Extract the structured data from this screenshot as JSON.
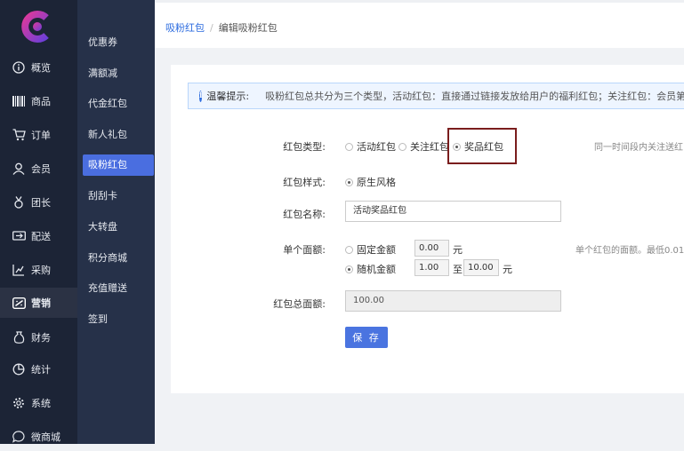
{
  "breadcrumb": {
    "parent": "吸粉红包",
    "current": "编辑吸粉红包"
  },
  "primary_nav": [
    {
      "label": "概览",
      "icon": "info-circle-icon"
    },
    {
      "label": "商品",
      "icon": "barcode-icon"
    },
    {
      "label": "订单",
      "icon": "cart-icon"
    },
    {
      "label": "会员",
      "icon": "user-icon"
    },
    {
      "label": "团长",
      "icon": "medal-icon"
    },
    {
      "label": "配送",
      "icon": "delivery-icon"
    },
    {
      "label": "采购",
      "icon": "purchase-icon"
    },
    {
      "label": "营销",
      "icon": "marketing-icon",
      "active": true
    },
    {
      "label": "财务",
      "icon": "money-bag-icon"
    },
    {
      "label": "统计",
      "icon": "pie-chart-icon"
    },
    {
      "label": "系统",
      "icon": "gear-icon"
    },
    {
      "label": "微商城",
      "icon": "chat-icon"
    }
  ],
  "secondary_nav": [
    {
      "label": "优惠券"
    },
    {
      "label": "满额减"
    },
    {
      "label": "代金红包"
    },
    {
      "label": "新人礼包"
    },
    {
      "label": "吸粉红包",
      "active": true
    },
    {
      "label": "刮刮卡"
    },
    {
      "label": "大转盘"
    },
    {
      "label": "积分商城"
    },
    {
      "label": "充值赠送"
    },
    {
      "label": "签到"
    }
  ],
  "notice": {
    "title": "温馨提示:",
    "text": "吸粉红包总共分为三个类型，活动红包：直接通过链接发放给用户的福利红包；关注红包：会员第一次"
  },
  "form": {
    "type_label": "红包类型:",
    "type_options": [
      "活动红包",
      "关注红包",
      "奖品红包"
    ],
    "type_selected": "奖品红包",
    "type_hint": "同一时间段内关注送红",
    "style_label": "红包样式:",
    "style_option": "原生风格",
    "name_label": "红包名称:",
    "name_value": "活动奖品红包",
    "amount_label": "单个面额:",
    "fixed_label": "固定金额",
    "fixed_value": "0.00",
    "random_label": "随机金额",
    "random_min": "1.00",
    "random_to": "至",
    "random_max": "10.00",
    "unit": "元",
    "amount_hint": "单个红包的面额。最低0.01",
    "total_label": "红包总面额:",
    "total_value": "100.00",
    "save_label": "保 存"
  },
  "colors": {
    "accent": "#4a74e0",
    "sidebar": "#1c2436",
    "subsidebar": "#263149",
    "highlight_box": "#7a1d1d"
  }
}
